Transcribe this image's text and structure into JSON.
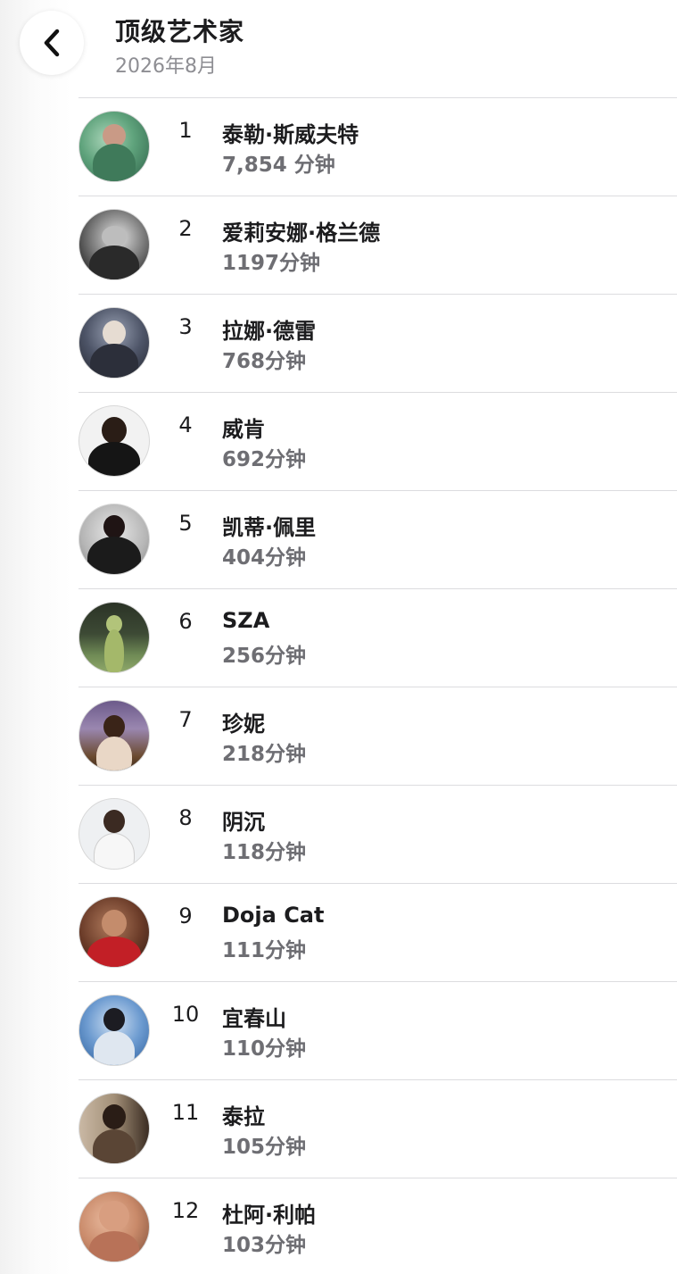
{
  "header": {
    "title": "顶级艺术家",
    "subtitle": "2026年8月"
  },
  "artists": [
    {
      "rank": "1",
      "name": "泰勒·斯威夫特",
      "minutes": "7,854 分钟"
    },
    {
      "rank": "2",
      "name": "爱莉安娜·格兰德",
      "minutes": "1197分钟"
    },
    {
      "rank": "3",
      "name": "拉娜·德雷",
      "minutes": "768分钟"
    },
    {
      "rank": "4",
      "name": "威肯",
      "minutes": "692分钟"
    },
    {
      "rank": "5",
      "name": "凯蒂·佩里",
      "minutes": "404分钟"
    },
    {
      "rank": "6",
      "name": "SZA",
      "minutes": "256分钟"
    },
    {
      "rank": "7",
      "name": "珍妮",
      "minutes": "218分钟"
    },
    {
      "rank": "8",
      "name": "阴沉",
      "minutes": "118分钟"
    },
    {
      "rank": "9",
      "name": "Doja Cat",
      "minutes": "111分钟"
    },
    {
      "rank": "10",
      "name": "宜春山",
      "minutes": "110分钟"
    },
    {
      "rank": "11",
      "name": "泰拉",
      "minutes": "105分钟"
    },
    {
      "rank": "12",
      "name": "杜阿·利帕",
      "minutes": "103分钟"
    }
  ],
  "icons": {
    "back": "chevron-left-icon"
  }
}
